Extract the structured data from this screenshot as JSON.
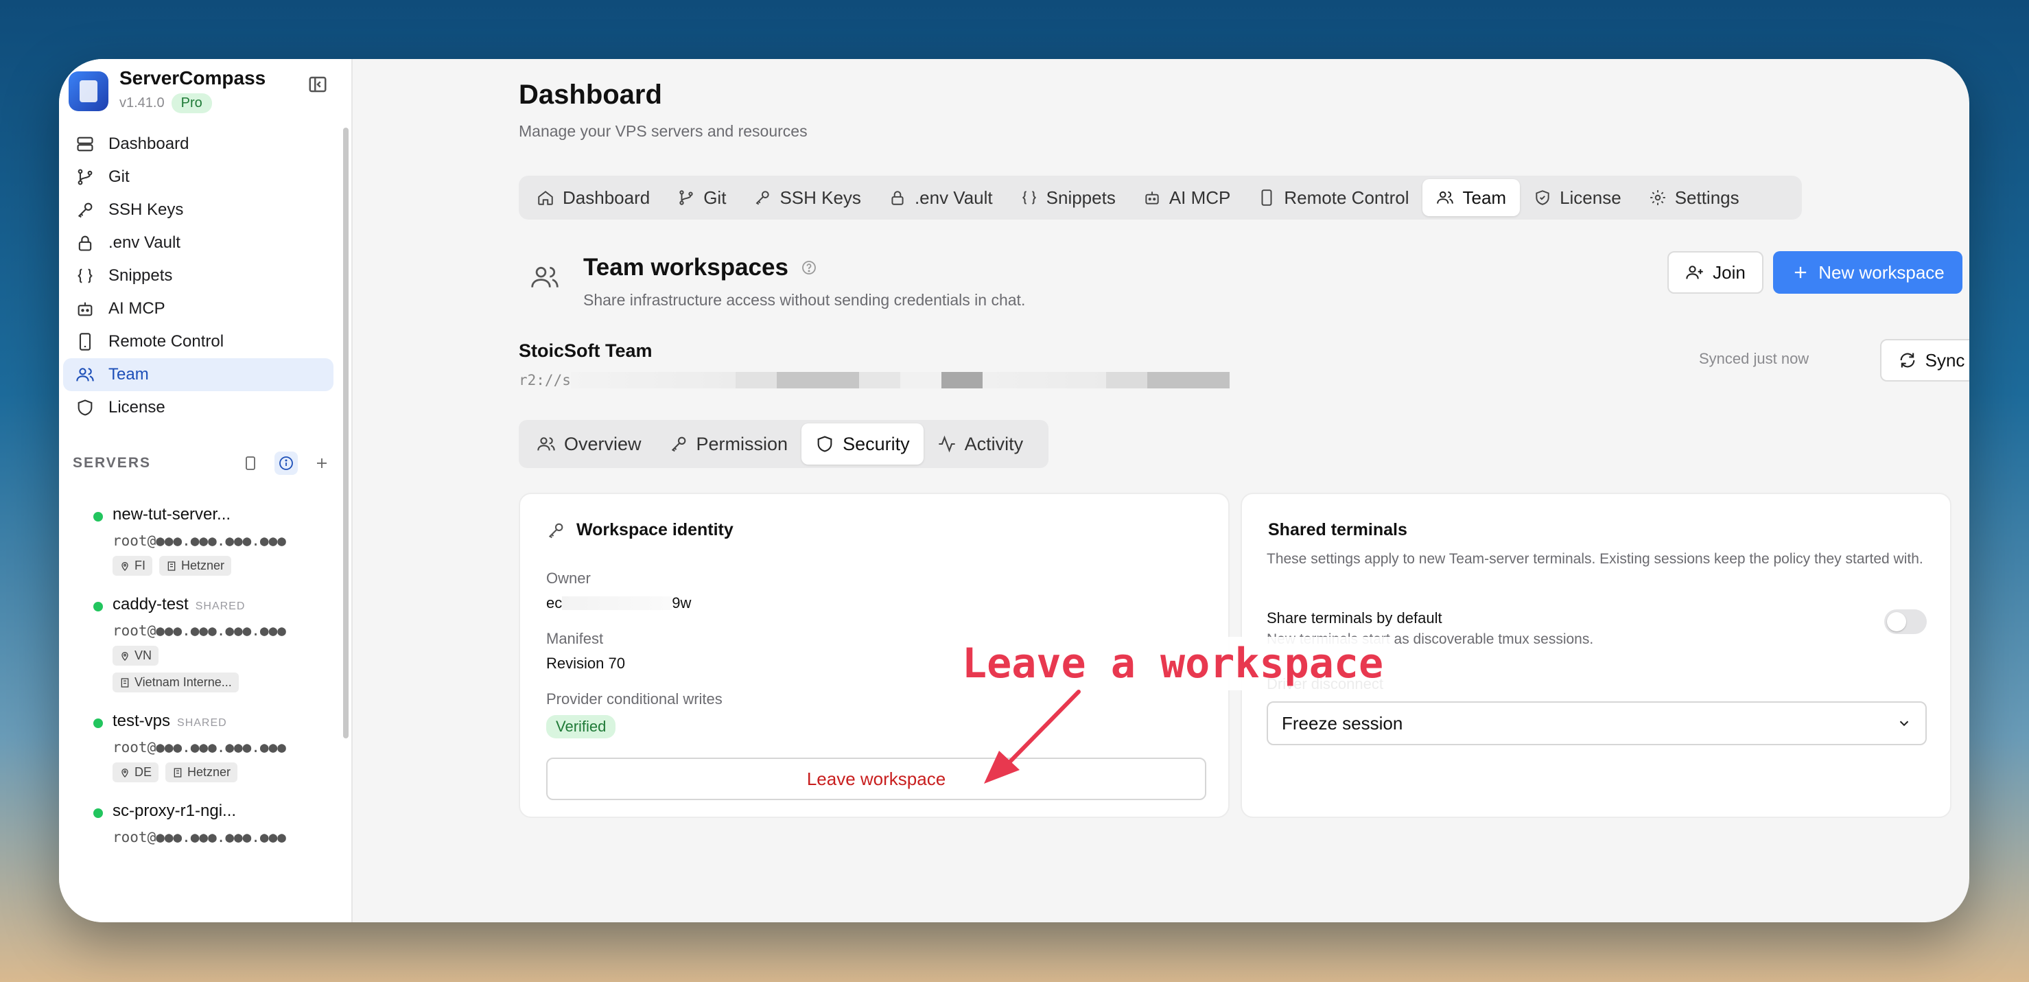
{
  "app": {
    "name": "ServerCompass",
    "version": "v1.41.0",
    "plan": "Pro"
  },
  "sidebar": {
    "items": [
      {
        "label": "Dashboard",
        "icon": "server-stack-icon"
      },
      {
        "label": "Git",
        "icon": "git-branch-icon"
      },
      {
        "label": "SSH Keys",
        "icon": "key-icon"
      },
      {
        "label": ".env Vault",
        "icon": "lock-icon"
      },
      {
        "label": "Snippets",
        "icon": "braces-icon"
      },
      {
        "label": "AI MCP",
        "icon": "bot-icon"
      },
      {
        "label": "Remote Control",
        "icon": "phone-icon"
      },
      {
        "label": "Team",
        "icon": "users-icon"
      },
      {
        "label": "License",
        "icon": "shield-icon"
      }
    ],
    "active": "Team",
    "servers_heading": "SERVERS",
    "servers": [
      {
        "name": "new-tut-server...",
        "shared": "",
        "host": "root@●●●.●●●.●●●.●●●",
        "tags": [
          "FI",
          "Hetzner"
        ]
      },
      {
        "name": "caddy-test",
        "shared": "SHARED",
        "host": "root@●●●.●●●.●●●.●●●",
        "tags": [
          "VN",
          "Vietnam Interne..."
        ]
      },
      {
        "name": "test-vps",
        "shared": "SHARED",
        "host": "root@●●●.●●●.●●●.●●●",
        "tags": [
          "DE",
          "Hetzner"
        ]
      },
      {
        "name": "sc-proxy-r1-ngi...",
        "shared": "",
        "host": "root@●●●.●●●.●●●.●●●",
        "tags": []
      }
    ]
  },
  "header": {
    "title": "Dashboard",
    "subtitle": "Manage your VPS servers and resources"
  },
  "tabs": [
    {
      "label": "Dashboard",
      "icon": "home-icon"
    },
    {
      "label": "Git",
      "icon": "git-branch-icon"
    },
    {
      "label": "SSH Keys",
      "icon": "key-icon"
    },
    {
      "label": ".env Vault",
      "icon": "lock-icon"
    },
    {
      "label": "Snippets",
      "icon": "braces-icon"
    },
    {
      "label": "AI MCP",
      "icon": "bot-icon"
    },
    {
      "label": "Remote Control",
      "icon": "phone-icon"
    },
    {
      "label": "Team",
      "icon": "users-icon"
    },
    {
      "label": "License",
      "icon": "shield-check-icon"
    },
    {
      "label": "Settings",
      "icon": "gear-icon"
    }
  ],
  "team": {
    "title": "Team workspaces",
    "subtitle": "Share infrastructure access without sending credentials in chat.",
    "join_label": "Join",
    "new_label": "New workspace",
    "workspace_name": "StoicSoft Team",
    "workspace_path_prefix": "r2://s",
    "synced_text": "Synced just now",
    "sync_label": "Sync now"
  },
  "subtabs": [
    {
      "label": "Overview",
      "icon": "users-icon"
    },
    {
      "label": "Permission",
      "icon": "key-icon"
    },
    {
      "label": "Security",
      "icon": "shield-icon"
    },
    {
      "label": "Activity",
      "icon": "activity-icon"
    }
  ],
  "identity": {
    "title": "Workspace identity",
    "owner_label": "Owner",
    "owner_value_start": "ec",
    "owner_value_end": "9w",
    "manifest_label": "Manifest",
    "manifest_value": "Revision 70",
    "writes_label": "Provider conditional writes",
    "writes_value": "Verified",
    "leave_label": "Leave workspace"
  },
  "terminals": {
    "title": "Shared terminals",
    "description": "These settings apply to new Team-server terminals. Existing sessions keep the policy they started with.",
    "option_label": "Share terminals by default",
    "option_sub": "New terminals start as discoverable tmux sessions.",
    "option_enabled": false,
    "driver_label": "Driver disconnect",
    "driver_value": "Freeze session"
  },
  "annotation": {
    "text": "Leave a workspace",
    "color": "#e8384f"
  },
  "colors": {
    "accent": "#3b82f6",
    "danger": "#c81e1e",
    "success": "#22c55e"
  }
}
